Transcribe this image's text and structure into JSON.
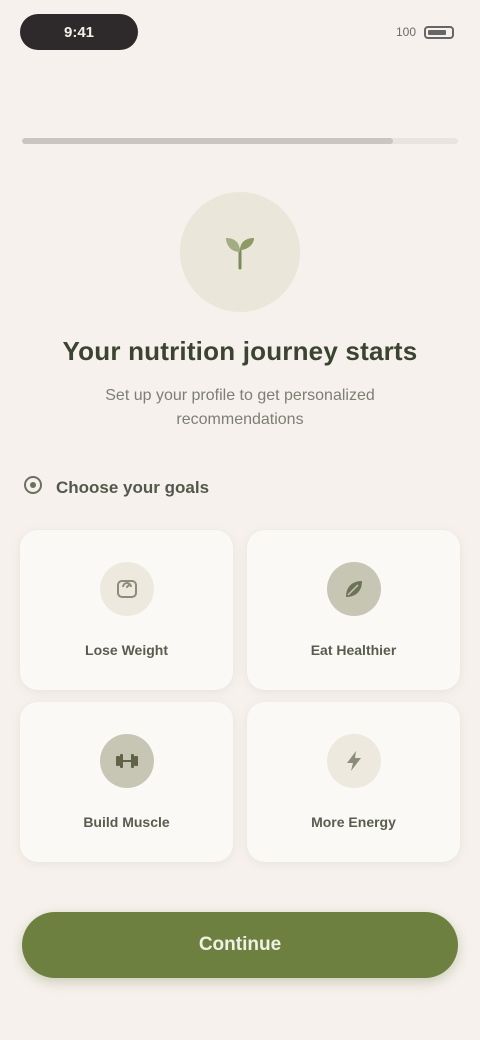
{
  "status_bar": {
    "time": "9:41",
    "battery": "100"
  },
  "onboarding": {
    "progress_fraction": 0.85
  },
  "hero": {
    "title": "Your nutrition journey starts",
    "subtitle": "Set up your profile to get personalized recommendations"
  },
  "section": {
    "title": "Choose your goals"
  },
  "goals": [
    {
      "label": "Lose Weight",
      "icon": "scale-icon"
    },
    {
      "label": "Eat Healthier",
      "icon": "leaf-icon"
    },
    {
      "label": "Build Muscle",
      "icon": "dumbbell-icon"
    },
    {
      "label": "More Energy",
      "icon": "bolt-icon"
    }
  ],
  "cta": {
    "label": "Continue"
  },
  "colors": {
    "background": "#f6f1ec",
    "accent": "#6d8040",
    "title": "#3b4430"
  }
}
